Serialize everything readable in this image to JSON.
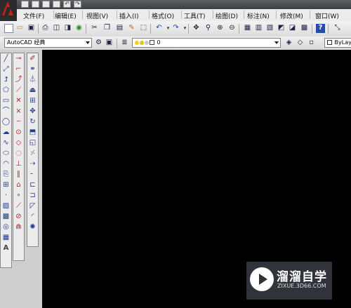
{
  "window": {
    "app_logo_letter": "A"
  },
  "quick_access": {
    "icons": [
      "new-icon",
      "open-icon",
      "save-icon",
      "print-icon",
      "undo-icon",
      "redo-icon"
    ]
  },
  "menu": {
    "items": [
      "文件(F)",
      "编辑(E)",
      "视图(V)",
      "插入(I)",
      "格式(O)",
      "工具(T)",
      "绘图(D)",
      "标注(N)",
      "修改(M)",
      "窗口(W)"
    ]
  },
  "standard_toolbar": {
    "icons": [
      "new-icon",
      "open-icon",
      "save-icon",
      "print-icon",
      "print-preview-icon",
      "publish-icon",
      "3d-publish-icon",
      "cut-icon",
      "copy-icon",
      "paste-icon",
      "match-properties-icon",
      "block-editor-icon",
      "undo-icon",
      "redo-icon",
      "pan-icon",
      "zoom-realtime-icon",
      "zoom-window-icon",
      "zoom-previous-icon",
      "properties-icon",
      "design-center-icon",
      "tool-palettes-icon",
      "sheet-set-icon",
      "markup-icon",
      "calculator-icon",
      "help-icon",
      "extra-icon"
    ]
  },
  "workspace": {
    "value": "AutoCAD 经典"
  },
  "layer": {
    "value": "0"
  },
  "properties": {
    "color_value": "ByLaye"
  },
  "watermark": {
    "title": "溜溜自学",
    "url": "ZIXUE.3D66.COM"
  },
  "colors": {
    "canvas": "#000000",
    "logo_red": "#d21c1c",
    "toolbar": "#e6e6e6"
  }
}
